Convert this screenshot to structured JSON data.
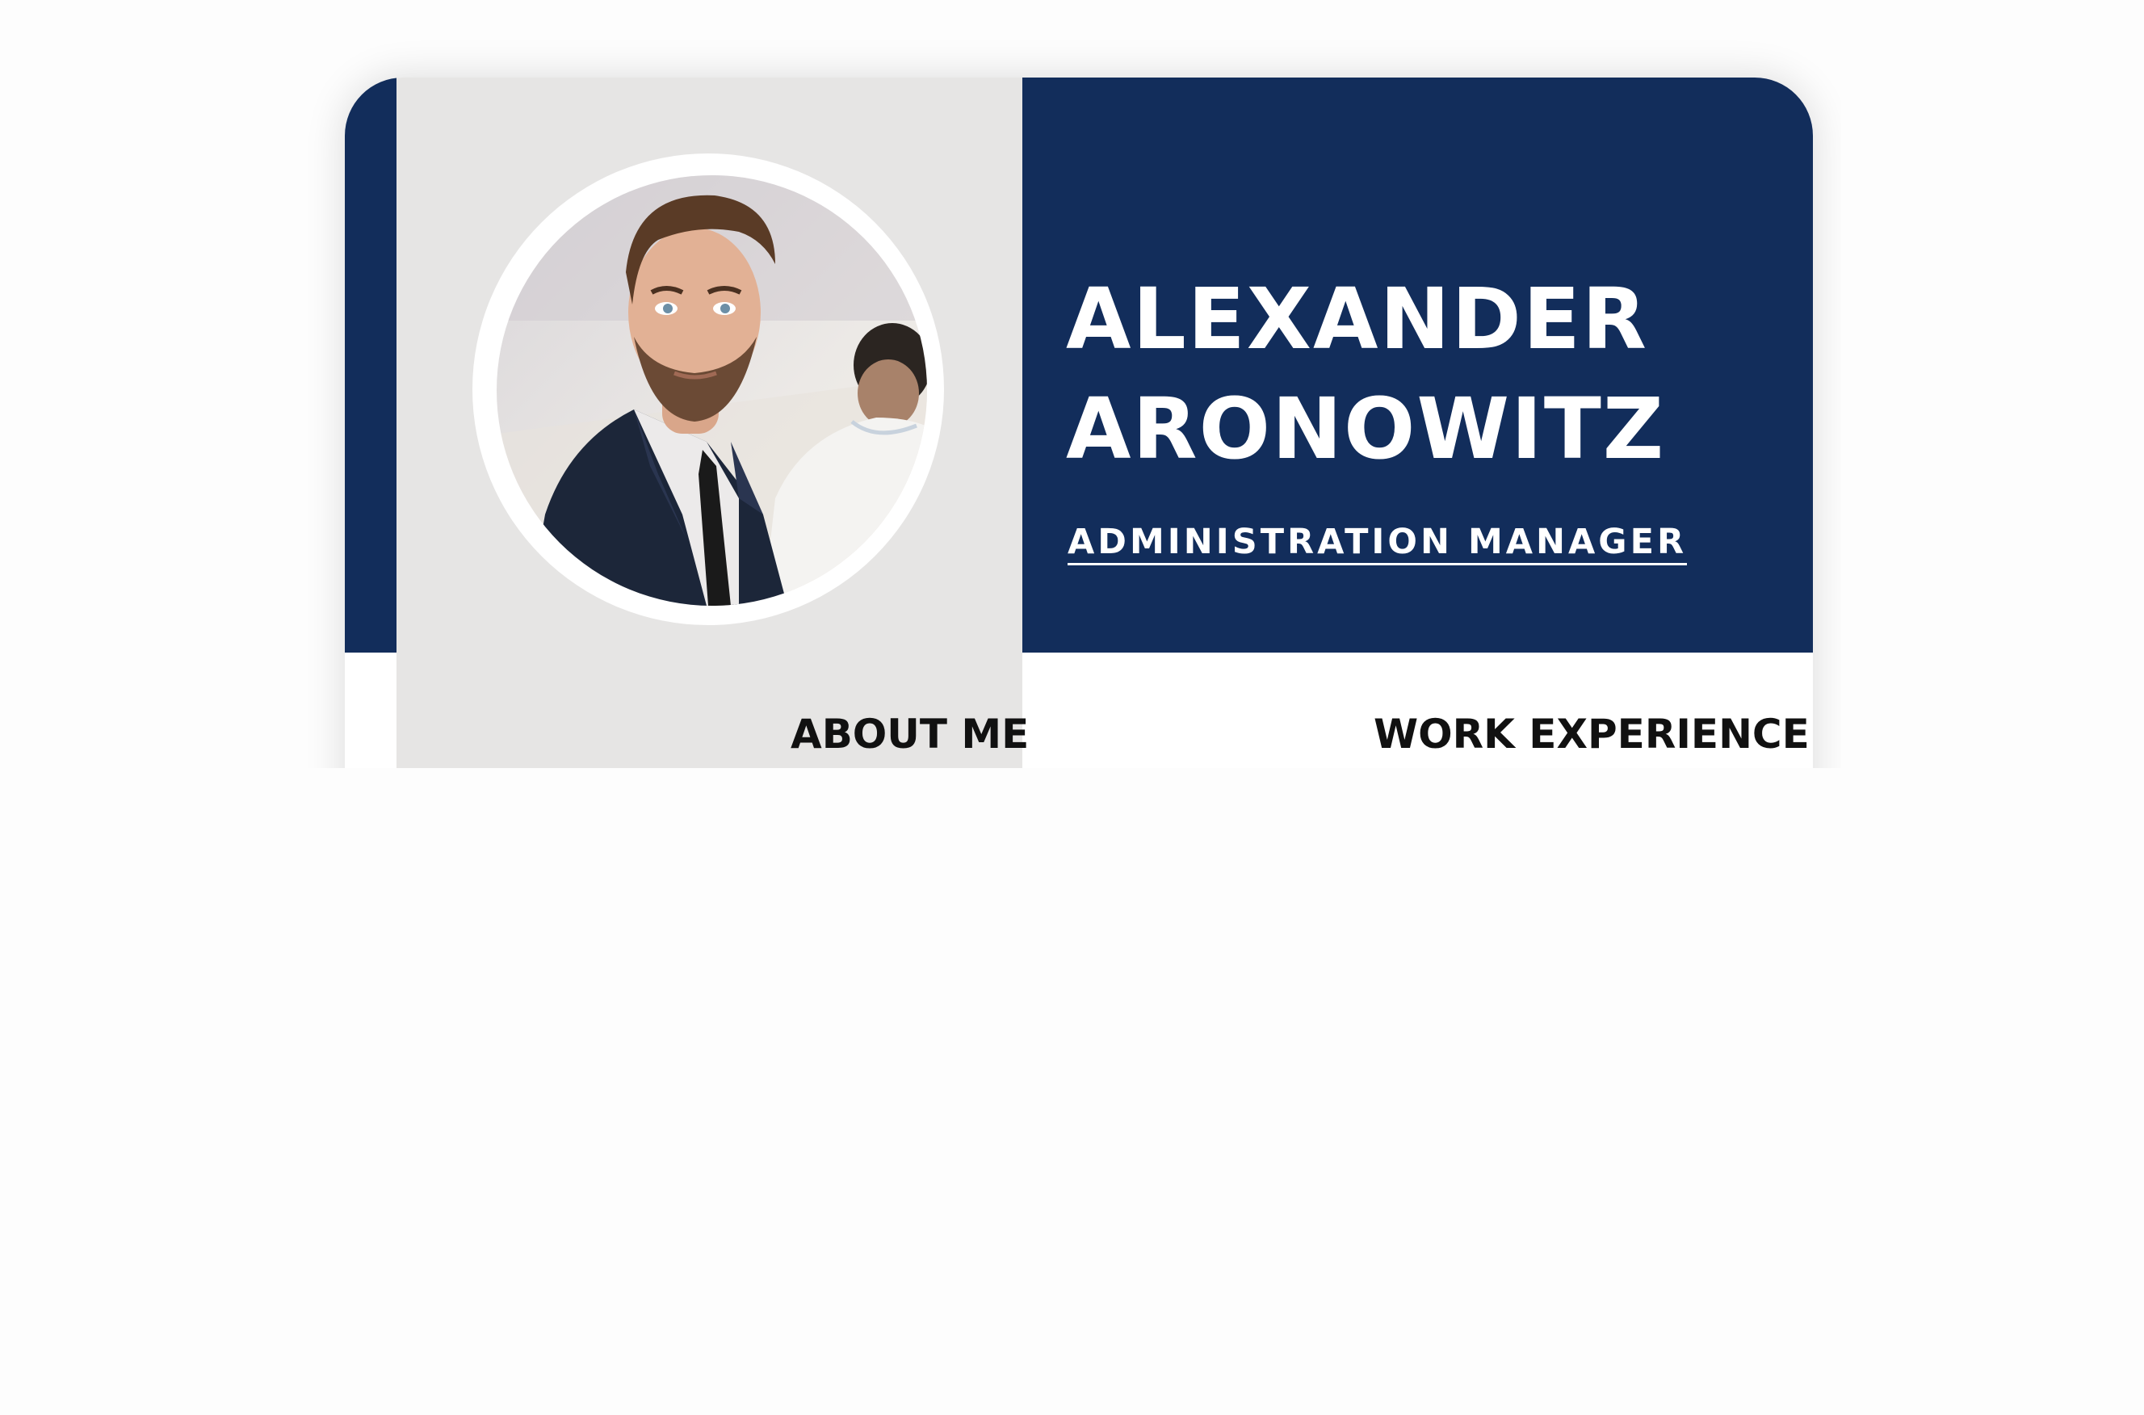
{
  "resume": {
    "first_name": "ALEXANDER",
    "last_name": "ARONOWITZ",
    "job_title": "ADMINISTRATION MANAGER",
    "sections": {
      "about_heading": "ABOUT ME",
      "work_heading": "WORK EXPERIENCE"
    }
  },
  "colors": {
    "navy": "#122d5b",
    "sidebar_gray": "#e6e5e4",
    "text_white": "#ffffff",
    "heading_black": "#111111"
  },
  "icons": {
    "profile_photo": "man-in-suit-portrait"
  }
}
